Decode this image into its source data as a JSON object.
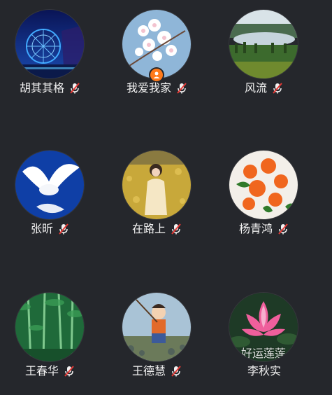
{
  "participants": [
    {
      "name": "胡其其格",
      "mic": "mic-muted-icon",
      "avatar": "ferris-wheel-night-avatar"
    },
    {
      "name": "我爱我家",
      "mic": "mic-muted-icon",
      "avatar": "cherry-blossom-avatar",
      "badge": "host-icon"
    },
    {
      "name": "风流",
      "mic": "mic-muted-icon",
      "avatar": "lake-landscape-avatar"
    },
    {
      "name": "张昕",
      "mic": "mic-muted-icon",
      "avatar": "white-dove-avatar"
    },
    {
      "name": "在路上",
      "mic": "mic-muted-icon",
      "avatar": "girl-in-field-avatar"
    },
    {
      "name": "杨青鸿",
      "mic": "mic-muted-icon",
      "avatar": "orange-flowers-avatar"
    },
    {
      "name": "王春华",
      "mic": "mic-muted-icon",
      "avatar": "bamboo-forest-avatar"
    },
    {
      "name": "王德慧",
      "mic": "mic-muted-icon",
      "avatar": "cartoon-boy-avatar"
    },
    {
      "name": "李秋实",
      "avatar": "lotus-avatar",
      "avatar_text": "好运莲莲"
    }
  ],
  "colors": {
    "background": "#25272c",
    "name_text": "#f2f2f2",
    "mic_muted_slash": "#e53935",
    "host_badge": "#ff7a1a"
  }
}
